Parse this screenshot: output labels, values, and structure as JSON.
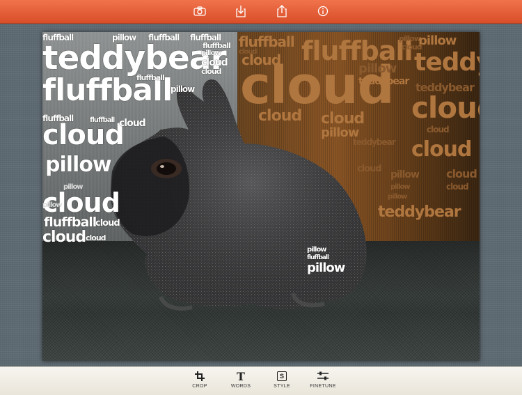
{
  "topbar": {
    "icons": [
      "camera-icon",
      "save-icon",
      "share-icon",
      "info-icon"
    ]
  },
  "canvas": {
    "words": {
      "w1": "fluffball",
      "w2": "pillow",
      "w3": "fluffball",
      "w4": "fluffball",
      "w5": "teddybear",
      "w6": "fluffball",
      "w7": "pillow",
      "w8": "cloud",
      "w9": "cloud",
      "w10": "fluffball",
      "w11": "fluffball",
      "w12": "pillow",
      "w13": "fluffball",
      "w14": "cloud",
      "w15": "fluffball",
      "w16": "cloud",
      "w17": "pillow",
      "w18": "cloud",
      "w19": "fluffball",
      "w20": "cloud",
      "w21": "cloud",
      "w22": "cloud",
      "w23": "pillow",
      "w24": "pillow",
      "w25": "pillow",
      "w26": "fluffball",
      "w27": "pillow",
      "w28": "fluffball",
      "w29": "cloud",
      "w30": "fluffball",
      "w31": "pillow",
      "w32": "pillow",
      "w33": "cloud",
      "w34": "cloud",
      "w35": "cloud",
      "w36": "teddybear",
      "w37": "pillow",
      "w38": "teddybear",
      "w39": "teddybear",
      "w40": "cloud",
      "w41": "cloud",
      "w42": "cloud",
      "w43": "pillow",
      "w44": "cloud",
      "w45": "cloud",
      "w46": "teddybear",
      "w47": "cloud",
      "w48": "cloud",
      "w49": "cloud",
      "w50": "pillow",
      "w51": "pillow",
      "w52": "pillow",
      "w53": "teddybear"
    }
  },
  "toolbar": {
    "crop_label": "CROP",
    "words_label": "WORDS",
    "style_label": "STYLE",
    "style_glyph": "S",
    "finetune_label": "FINETUNE",
    "words_glyph": "T"
  },
  "colors": {
    "accent": "#e85d35",
    "bar": "#f3f0e8"
  }
}
